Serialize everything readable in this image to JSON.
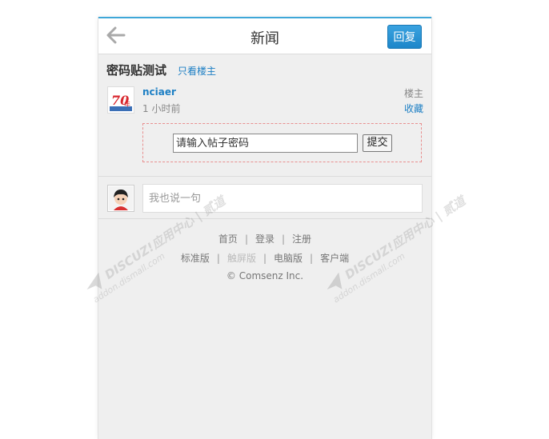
{
  "header": {
    "title": "新闻",
    "reply_label": "回复"
  },
  "thread": {
    "title": "密码贴测试",
    "only_owner_label": "只看楼主"
  },
  "post": {
    "author": "nciaer",
    "time": "1 小时前",
    "floor": "楼主",
    "favorite_label": "收藏",
    "password_placeholder": "请输入帖子密码",
    "submit_label": "提交"
  },
  "comment": {
    "placeholder": "我也说一句"
  },
  "footer": {
    "nav1": [
      "首页",
      "登录",
      "注册"
    ],
    "nav2": [
      "标准版",
      "触屏版",
      "电脑版",
      "客户端"
    ],
    "copyright": "© Comsenz Inc."
  },
  "watermarks": [
    {
      "brand": "DISCUZ!应用中心 | 贰道",
      "site": "addon.dismall.com"
    },
    {
      "brand": "DISCUZ!应用中心 | 贰道",
      "site": "addon.dismall.com"
    }
  ],
  "colors": {
    "accent": "#1d7fc4",
    "topbar_border": "#3fa7d8",
    "password_border": "#e88f8f"
  }
}
